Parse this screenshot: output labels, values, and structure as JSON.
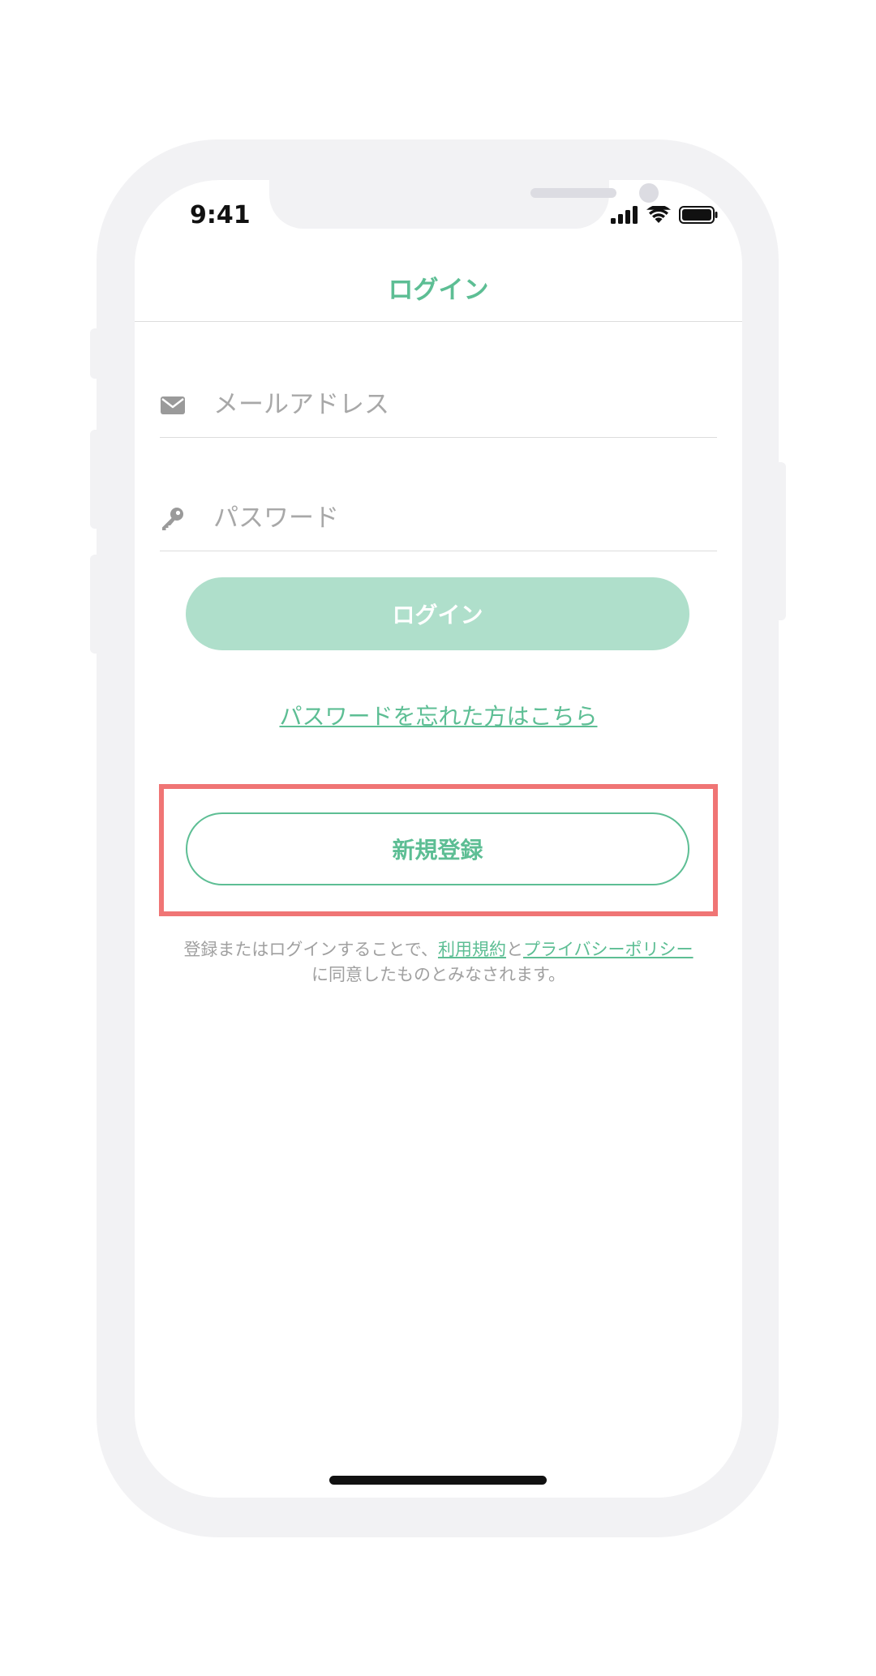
{
  "status_bar": {
    "time": "9:41",
    "icons": [
      "cellular-signal-icon",
      "wifi-icon",
      "battery-icon"
    ]
  },
  "nav": {
    "title": "ログイン"
  },
  "form": {
    "email_placeholder": "メールアドレス",
    "email_icon": "mail-icon",
    "password_placeholder": "パスワード",
    "password_icon": "key-icon",
    "login_label": "ログイン",
    "forgot_label": "パスワードを忘れた方はこちら",
    "signup_label": "新規登録"
  },
  "terms": {
    "prefix": "登録またはログインすることで、",
    "terms_link": "利用規約",
    "and": "と",
    "privacy_link": "プライバシーポリシー",
    "suffix": "に同意したものとみなされます。"
  },
  "colors": {
    "accent": "#5dbe94",
    "button_fill": "#afdfcb",
    "highlight": "#f07575",
    "frame": "#f2f2f4"
  }
}
